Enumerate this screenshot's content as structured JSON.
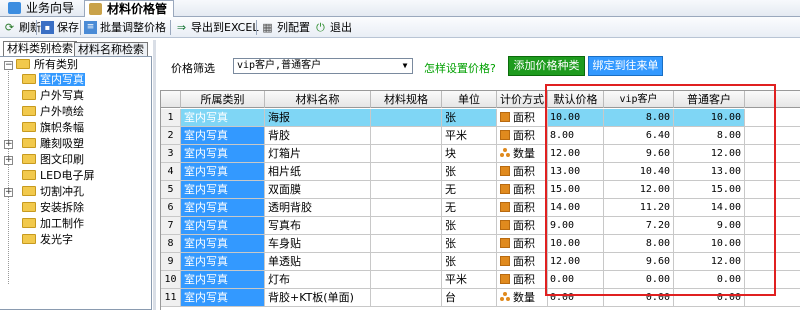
{
  "tabs": [
    {
      "label": "业务向导",
      "icon": "home-icon"
    },
    {
      "label": "材料价格管理",
      "icon": "price-icon"
    }
  ],
  "toolbar": {
    "refresh": "刷新",
    "save": "保存",
    "batch": "批量调整价格",
    "export": "导出到EXCEL",
    "columns": "列配置",
    "exit": "退出"
  },
  "left_tabs": [
    "材料类别检索",
    "材料名称检索"
  ],
  "tree": {
    "root": "所有类别",
    "items": [
      "室内写真",
      "户外写真",
      "户外喷绘",
      "旗帜条幅",
      "雕刻吸塑",
      "图文印刷",
      "LED电子屏",
      "切割冲孔",
      "安装拆除",
      "加工制作",
      "发光字"
    ],
    "selected": 0
  },
  "filter": {
    "label": "价格筛选",
    "value": "vip客户,普通客户",
    "howto": "怎样设置价格?",
    "add_button": "添加价格种类",
    "bind_button": "绑定到往来单位"
  },
  "grid": {
    "headers": [
      "所属类别",
      "材料名称",
      "材料规格",
      "单位",
      "计价方式",
      "默认价格",
      "vip客户",
      "普通客户"
    ],
    "rows": [
      {
        "n": "1",
        "cat": "室内写真",
        "name": "海报",
        "spec": "",
        "unit": "张",
        "method": "面积",
        "def": "10.00",
        "vip": "8.00",
        "norm": "10.00"
      },
      {
        "n": "2",
        "cat": "室内写真",
        "name": "背胶",
        "spec": "",
        "unit": "平米",
        "method": "面积",
        "def": "8.00",
        "vip": "6.40",
        "norm": "8.00"
      },
      {
        "n": "3",
        "cat": "室内写真",
        "name": "灯箱片",
        "spec": "",
        "unit": "块",
        "method": "数量",
        "def": "12.00",
        "vip": "9.60",
        "norm": "12.00"
      },
      {
        "n": "4",
        "cat": "室内写真",
        "name": "相片纸",
        "spec": "",
        "unit": "张",
        "method": "面积",
        "def": "13.00",
        "vip": "10.40",
        "norm": "13.00"
      },
      {
        "n": "5",
        "cat": "室内写真",
        "name": "双面膜",
        "spec": "",
        "unit": "无",
        "method": "面积",
        "def": "15.00",
        "vip": "12.00",
        "norm": "15.00"
      },
      {
        "n": "6",
        "cat": "室内写真",
        "name": "透明背胶",
        "spec": "",
        "unit": "无",
        "method": "面积",
        "def": "14.00",
        "vip": "11.20",
        "norm": "14.00"
      },
      {
        "n": "7",
        "cat": "室内写真",
        "name": "写真布",
        "spec": "",
        "unit": "张",
        "method": "面积",
        "def": "9.00",
        "vip": "7.20",
        "norm": "9.00"
      },
      {
        "n": "8",
        "cat": "室内写真",
        "name": "车身贴",
        "spec": "",
        "unit": "张",
        "method": "面积",
        "def": "10.00",
        "vip": "8.00",
        "norm": "10.00"
      },
      {
        "n": "9",
        "cat": "室内写真",
        "name": "单透贴",
        "spec": "",
        "unit": "张",
        "method": "面积",
        "def": "12.00",
        "vip": "9.60",
        "norm": "12.00"
      },
      {
        "n": "10",
        "cat": "室内写真",
        "name": "灯布",
        "spec": "",
        "unit": "平米",
        "method": "面积",
        "def": "0.00",
        "vip": "0.00",
        "norm": "0.00"
      },
      {
        "n": "11",
        "cat": "室内写真",
        "name": "背胶+KT板(单面)",
        "spec": "",
        "unit": "台",
        "method": "数量",
        "def": "0.00",
        "vip": "0.00",
        "norm": "0.00"
      }
    ],
    "selected_row": 0
  },
  "colors": {
    "selection": "#3399ff",
    "row_highlight": "#7fd6f5",
    "add_button": "#1e9b1e",
    "bind_button": "#3399ff",
    "highlight_box": "#e02020",
    "price_mark": "#e08a1e"
  }
}
